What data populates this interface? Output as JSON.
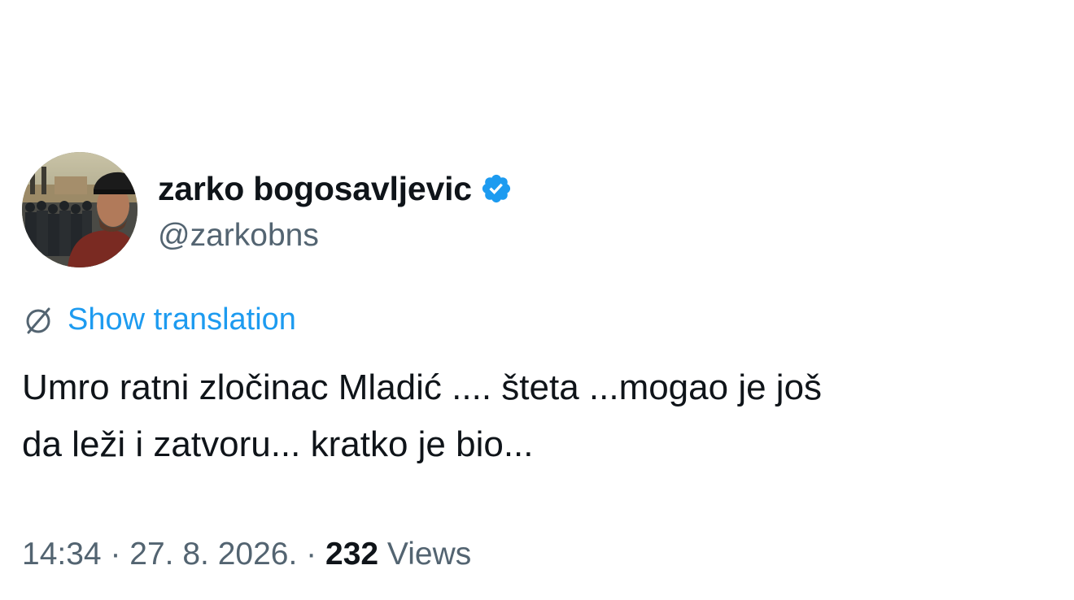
{
  "author": {
    "display_name": "zarko bogosavljevic",
    "handle": "@zarkobns",
    "verified_icon": "verified-badge-icon",
    "avatar_icon": "profile-photo"
  },
  "translation": {
    "icon": "globe-translate-icon",
    "label": "Show translation"
  },
  "tweet": {
    "text": "Umro ratni zločinac Mladić .... šteta ...mogao je još\nda leži i zatvoru... kratko je bio..."
  },
  "footer": {
    "time": "14:34",
    "separator": "·",
    "date": "27. 8. 2026.",
    "views_count": "232",
    "views_label": "Views"
  },
  "colors": {
    "accent": "#1d9bf0",
    "text": "#0f1419",
    "secondary": "#536471"
  }
}
